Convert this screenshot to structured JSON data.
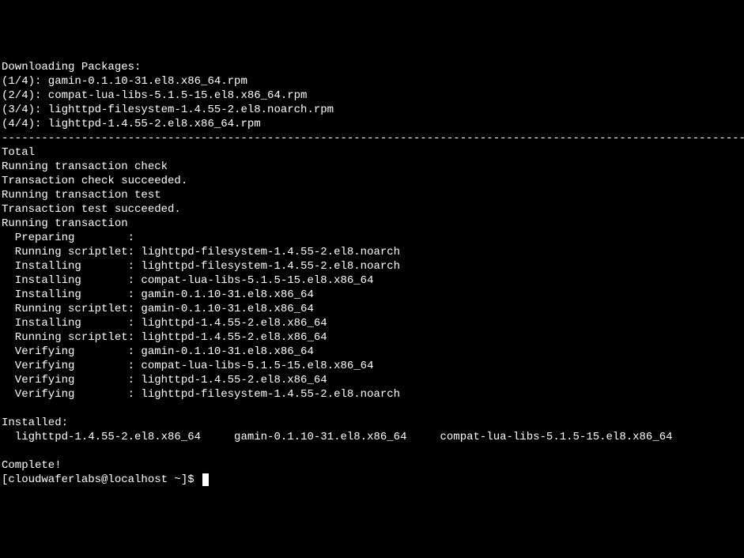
{
  "lines": {
    "l0": "Downloading Packages:",
    "l1": "(1/4): gamin-0.1.10-31.el8.x86_64.rpm",
    "l2": "(2/4): compat-lua-libs-5.1.5-15.el8.x86_64.rpm",
    "l3": "(3/4): lighttpd-filesystem-1.4.55-2.el8.noarch.rpm",
    "l4": "(4/4): lighttpd-1.4.55-2.el8.x86_64.rpm",
    "l5": "--------------------------------------------------------------------------------------------------------------------",
    "l6": "Total",
    "l7": "Running transaction check",
    "l8": "Transaction check succeeded.",
    "l9": "Running transaction test",
    "l10": "Transaction test succeeded.",
    "l11": "Running transaction",
    "l12": "  Preparing        :",
    "l13": "  Running scriptlet: lighttpd-filesystem-1.4.55-2.el8.noarch",
    "l14": "  Installing       : lighttpd-filesystem-1.4.55-2.el8.noarch",
    "l15": "  Installing       : compat-lua-libs-5.1.5-15.el8.x86_64",
    "l16": "  Installing       : gamin-0.1.10-31.el8.x86_64",
    "l17": "  Running scriptlet: gamin-0.1.10-31.el8.x86_64",
    "l18": "  Installing       : lighttpd-1.4.55-2.el8.x86_64",
    "l19": "  Running scriptlet: lighttpd-1.4.55-2.el8.x86_64",
    "l20": "  Verifying        : gamin-0.1.10-31.el8.x86_64",
    "l21": "  Verifying        : compat-lua-libs-5.1.5-15.el8.x86_64",
    "l22": "  Verifying        : lighttpd-1.4.55-2.el8.x86_64",
    "l23": "  Verifying        : lighttpd-filesystem-1.4.55-2.el8.noarch",
    "l24": "",
    "l25": "Installed:",
    "l26": "  lighttpd-1.4.55-2.el8.x86_64     gamin-0.1.10-31.el8.x86_64     compat-lua-libs-5.1.5-15.el8.x86_64",
    "l27": "",
    "l28": "Complete!"
  },
  "prompt": "[cloudwaferlabs@localhost ~]$ "
}
